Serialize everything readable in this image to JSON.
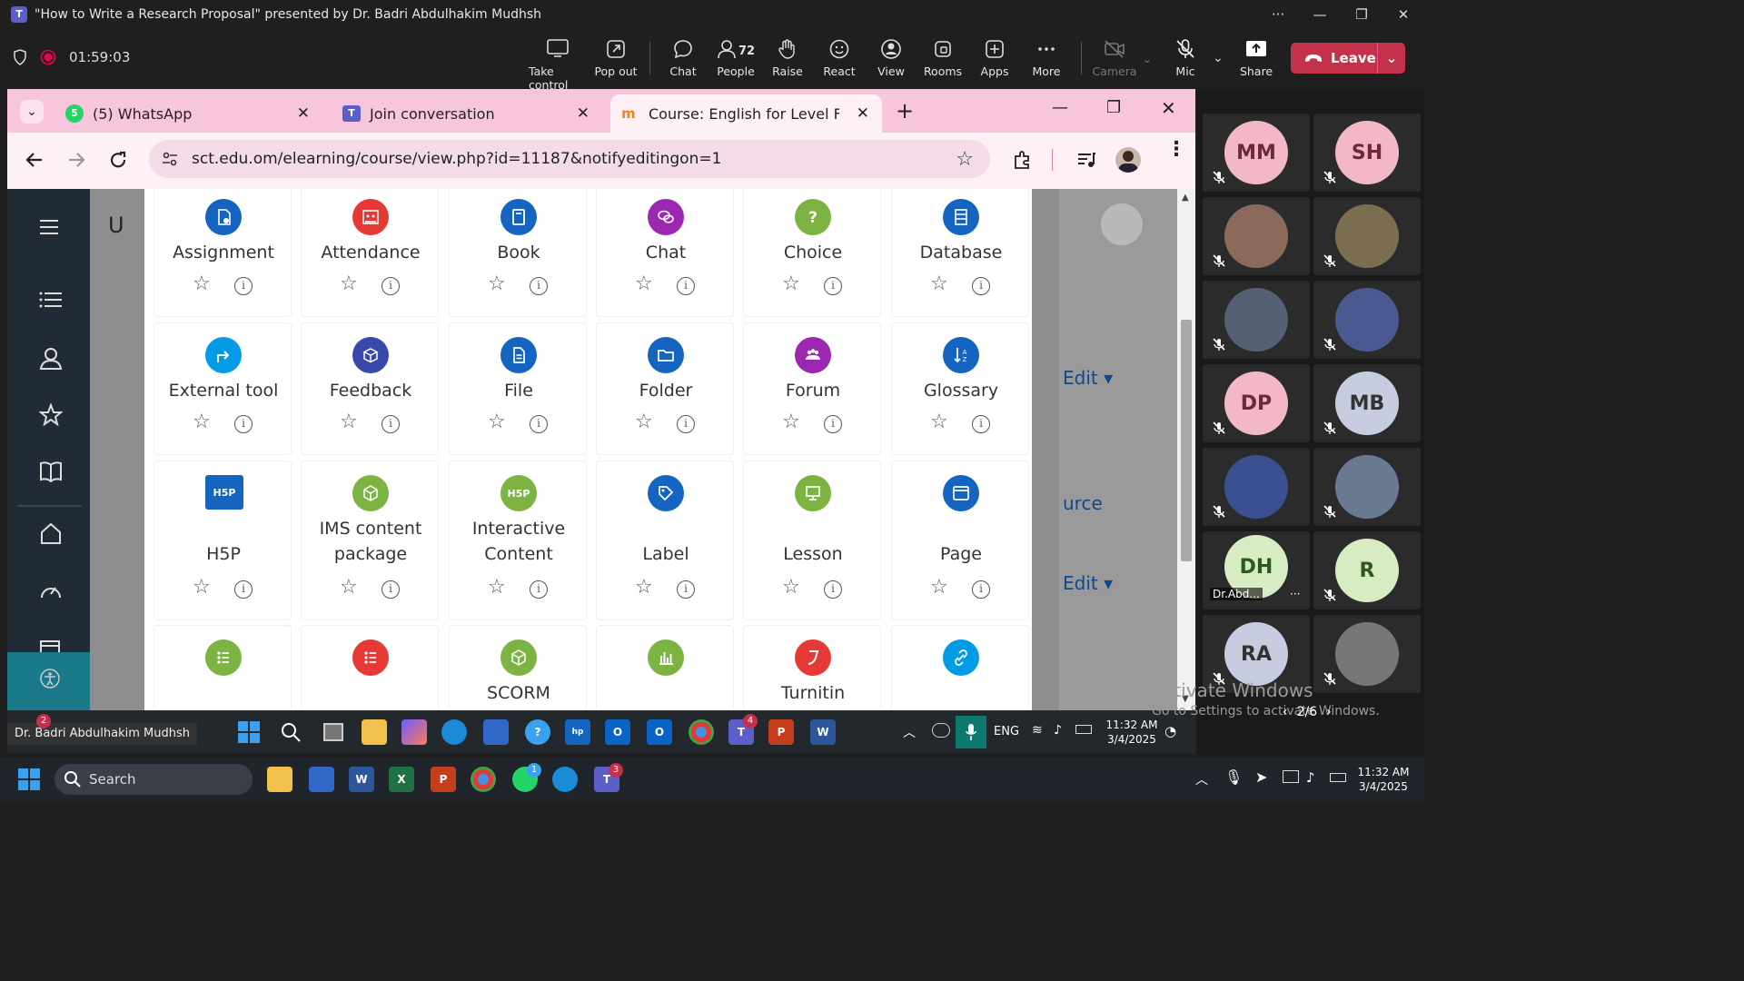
{
  "window": {
    "title": "\"How to Write a Research Proposal\" presented by Dr. Badri Abdulhakim Mudhsh"
  },
  "meeting": {
    "timer": "01:59:03"
  },
  "toolbar": {
    "take_control": "Take control",
    "pop_out": "Pop out",
    "chat": "Chat",
    "people": "People",
    "people_count": "72",
    "raise": "Raise",
    "react": "React",
    "view": "View",
    "rooms": "Rooms",
    "apps": "Apps",
    "more": "More",
    "camera": "Camera",
    "mic": "Mic",
    "share": "Share",
    "leave": "Leave"
  },
  "browser": {
    "tabs": [
      {
        "label": "(5) WhatsApp",
        "badge": "5"
      },
      {
        "label": "Join conversation"
      },
      {
        "label": "Course: English for Level Four -"
      }
    ],
    "url": "sct.edu.om/elearning/course/view.php?id=11187&notifyeditingon=1"
  },
  "moodle": {
    "page_fragments": {
      "edit1": "Edit",
      "resource": "urce",
      "edit2": "Edit",
      "left_letter": "U"
    },
    "activities": [
      {
        "name": "Assignment",
        "icon": "assignment-icon",
        "color": "#1565c0"
      },
      {
        "name": "Attendance",
        "icon": "attendance-icon",
        "color": "#e53935"
      },
      {
        "name": "Book",
        "icon": "book-icon",
        "color": "#1565c0"
      },
      {
        "name": "Chat",
        "icon": "chat-icon",
        "color": "#9c27b0"
      },
      {
        "name": "Choice",
        "icon": "question-icon",
        "color": "#7cb342"
      },
      {
        "name": "Database",
        "icon": "database-icon",
        "color": "#1565c0"
      },
      {
        "name": "External tool",
        "icon": "external-tool-icon",
        "color": "#039be5"
      },
      {
        "name": "Feedback",
        "icon": "feedback-icon",
        "color": "#3949ab"
      },
      {
        "name": "File",
        "icon": "file-icon",
        "color": "#1565c0"
      },
      {
        "name": "Folder",
        "icon": "folder-icon",
        "color": "#1565c0"
      },
      {
        "name": "Forum",
        "icon": "forum-icon",
        "color": "#9c27b0"
      },
      {
        "name": "Glossary",
        "icon": "glossary-icon",
        "color": "#1565c0"
      },
      {
        "name": "H5P",
        "icon": "h5p-icon",
        "color": "#1565c0"
      },
      {
        "name": "IMS content package",
        "icon": "package-icon",
        "color": "#7cb342"
      },
      {
        "name": "Interactive Content",
        "icon": "h5p-icon",
        "color": "#7cb342"
      },
      {
        "name": "Label",
        "icon": "label-icon",
        "color": "#1565c0"
      },
      {
        "name": "Lesson",
        "icon": "lesson-icon",
        "color": "#7cb342"
      },
      {
        "name": "Page",
        "icon": "page-icon",
        "color": "#1565c0"
      },
      {
        "name": "",
        "icon": "list-icon",
        "color": "#7cb342"
      },
      {
        "name": "",
        "icon": "list-icon",
        "color": "#e53935"
      },
      {
        "name": "SCORM",
        "icon": "package-icon",
        "color": "#7cb342"
      },
      {
        "name": "",
        "icon": "chart-icon",
        "color": "#7cb342"
      },
      {
        "name": "Turnitin",
        "icon": "turnitin-icon",
        "color": "#e53935"
      },
      {
        "name": "",
        "icon": "url-icon",
        "color": "#039be5"
      }
    ]
  },
  "share_taskbar": {
    "presenter": "Dr. Badri Abdulhakim Mudhsh",
    "lang": "ENG",
    "time": "11:32 AM",
    "date": "3/4/2025",
    "badge1": "2",
    "badge2": "4"
  },
  "participants": [
    {
      "initials": "MM",
      "color": "#f2b8c6",
      "text": "#6b2a3a"
    },
    {
      "initials": "SH",
      "color": "#f2b8c6",
      "text": "#6b2a3a"
    },
    {
      "initials": "",
      "color": "#8a6a5a"
    },
    {
      "initials": "",
      "color": "#7a6d50"
    },
    {
      "initials": "",
      "color": "#556070"
    },
    {
      "initials": "",
      "color": "#4a5a90"
    },
    {
      "initials": "DP",
      "color": "#f2b8c6",
      "text": "#6b2a3a"
    },
    {
      "initials": "MB",
      "color": "#c7ccdf",
      "text": "#333"
    },
    {
      "initials": "",
      "color": "#3a4f90"
    },
    {
      "initials": "",
      "color": "#6a7a90"
    },
    {
      "initials": "DH",
      "color": "#d8ecc4",
      "text": "#2c5a1e",
      "name": "Dr.Abd..."
    },
    {
      "initials": "R",
      "color": "#d8ecc4",
      "text": "#2c5a1e"
    },
    {
      "initials": "RA",
      "color": "#c7ccdf",
      "text": "#333"
    },
    {
      "initials": "",
      "color": "#777"
    }
  ],
  "gallery": {
    "page": "2/6",
    "watermark1": "Activate Windows",
    "watermark2": "Go to Settings to activate Windows."
  },
  "windows_taskbar": {
    "search": "Search",
    "time": "11:32 AM",
    "date": "3/4/2025",
    "teams_badge": "3",
    "wa_badge": "1"
  }
}
